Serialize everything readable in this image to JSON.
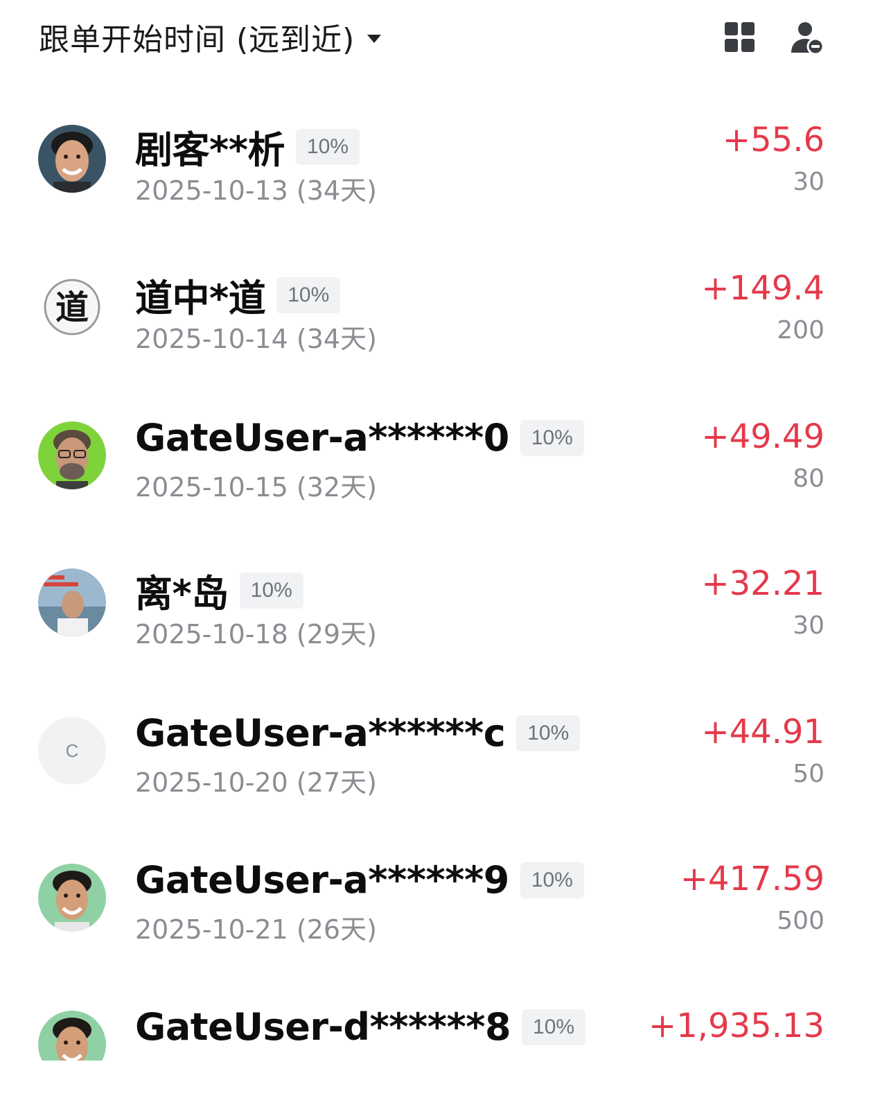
{
  "header": {
    "sort_label": "跟单开始时间 (远到近)",
    "icons": [
      "grid-icon",
      "person-remove-icon"
    ]
  },
  "colors": {
    "profit": "#e5394a",
    "muted": "#8a8d92",
    "badge_bg": "#f1f2f4"
  },
  "traders": [
    {
      "name": "剧客**析",
      "ratio": "10%",
      "date": "2025-10-13 (34天)",
      "profit": "+55.6",
      "amount": "30",
      "avatar": "photo-man-smiling"
    },
    {
      "name": "道中*道",
      "ratio": "10%",
      "date": "2025-10-14 (34天)",
      "profit": "+149.4",
      "amount": "200",
      "avatar": "calligraphy-dao",
      "avatar_text": "道"
    },
    {
      "name": "GateUser-a******0",
      "ratio": "10%",
      "date": "2025-10-15 (32天)",
      "profit": "+49.49",
      "amount": "80",
      "avatar": "photo-man-glasses-green"
    },
    {
      "name": "离*岛",
      "ratio": "10%",
      "date": "2025-10-18 (29天)",
      "profit": "+32.21",
      "amount": "30",
      "avatar": "photo-elder-man-lake"
    },
    {
      "name": "GateUser-a******c",
      "ratio": "10%",
      "date": "2025-10-20 (27天)",
      "profit": "+44.91",
      "amount": "50",
      "avatar": "letter-c",
      "avatar_text": "C"
    },
    {
      "name": "GateUser-a******9",
      "ratio": "10%",
      "date": "2025-10-21 (26天)",
      "profit": "+417.59",
      "amount": "500",
      "avatar": "photo-man-smiling-green"
    },
    {
      "name": "GateUser-d******8",
      "ratio": "10%",
      "date": "",
      "profit": "+1,935.13",
      "amount": "",
      "avatar": "photo-man-smiling-green"
    }
  ]
}
